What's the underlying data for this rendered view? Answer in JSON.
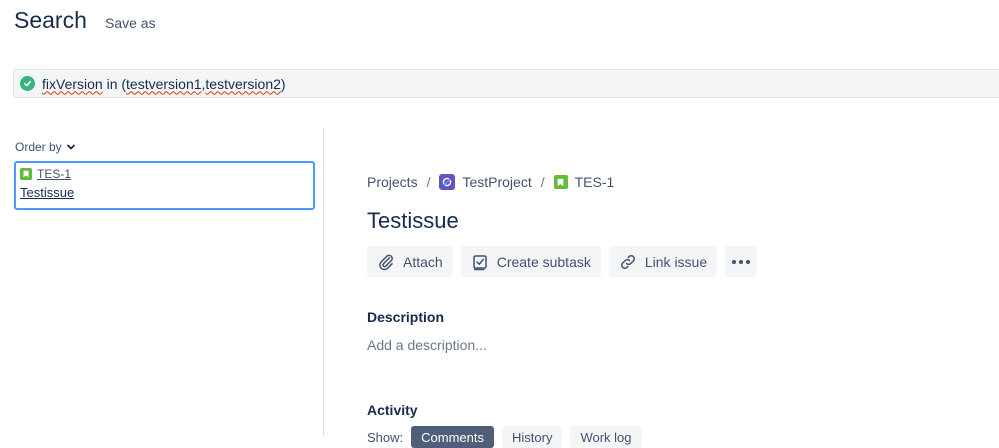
{
  "header": {
    "title": "Search",
    "save_as": "Save as"
  },
  "jql": {
    "field": "fixVersion",
    "operator": " in (",
    "value1": "testversion1",
    "comma": ",",
    "value2": "testversion2",
    "close": ")",
    "status_color": "#36b37e"
  },
  "sidebar": {
    "order_by": "Order by",
    "issues": [
      {
        "key": "TES-1",
        "summary": "Testissue"
      }
    ]
  },
  "issue": {
    "breadcrumb": {
      "projects": "Projects",
      "project": "TestProject",
      "key": "TES-1"
    },
    "title": "Testissue",
    "actions": {
      "attach": "Attach",
      "create_subtask": "Create subtask",
      "link_issue": "Link issue"
    },
    "description_heading": "Description",
    "description_placeholder": "Add a description...",
    "activity_heading": "Activity",
    "show_label": "Show:",
    "activity_tabs": [
      "Comments",
      "History",
      "Work log"
    ]
  },
  "colors": {
    "accent": "#4c9aff",
    "story": "#63ba3c",
    "project": "#6554c0"
  }
}
